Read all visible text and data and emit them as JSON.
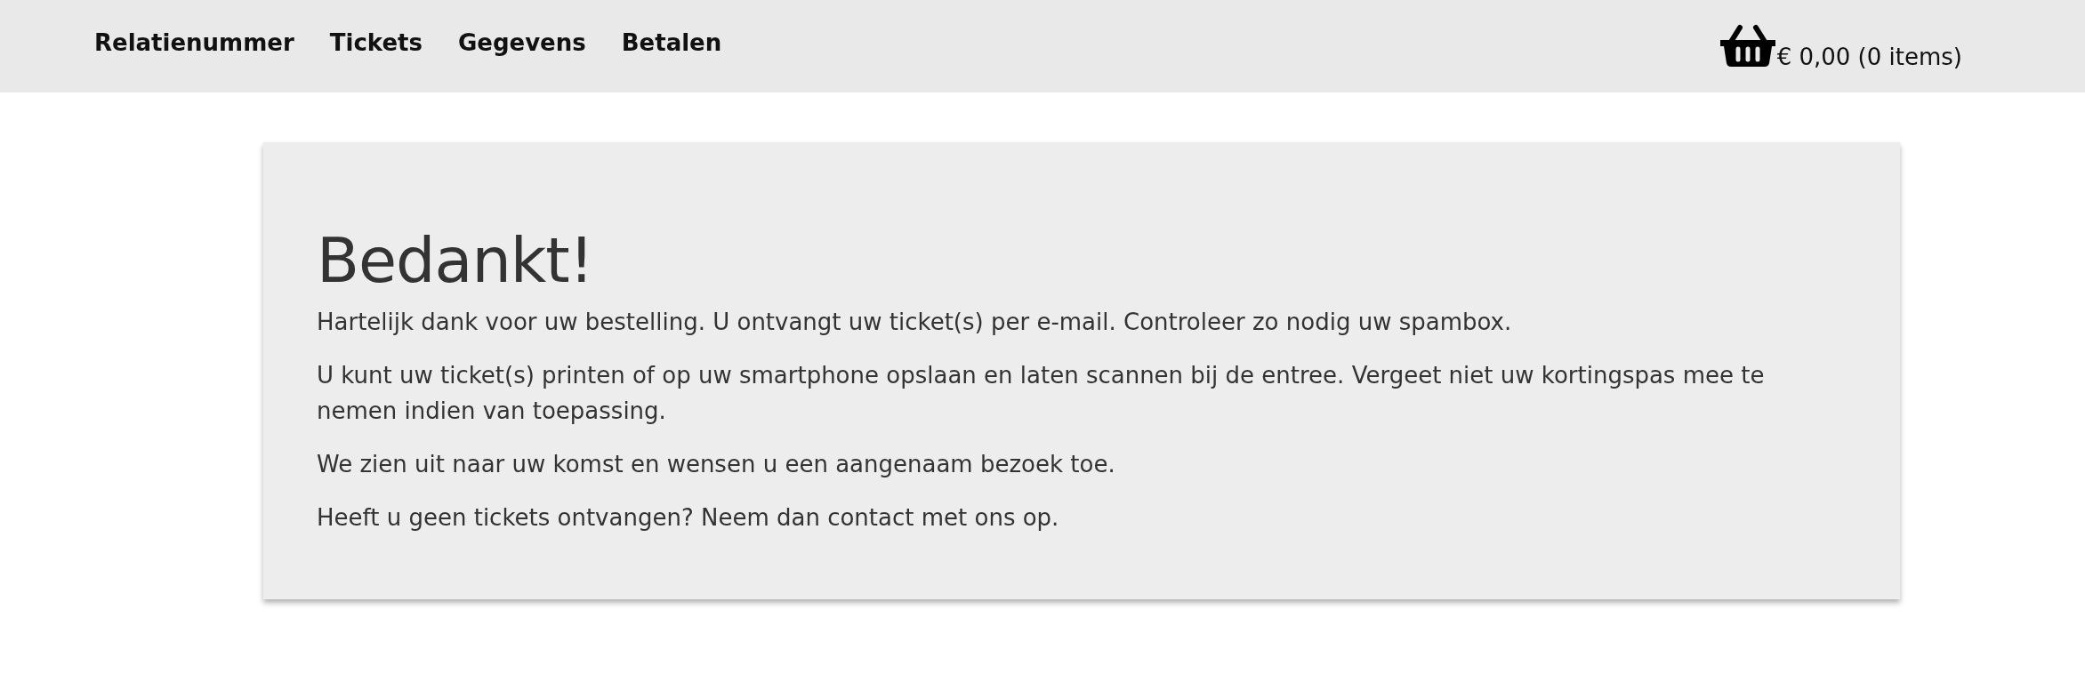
{
  "nav": {
    "items": [
      "Relatienummer",
      "Tickets",
      "Gegevens",
      "Betalen"
    ]
  },
  "cart": {
    "summary": "€ 0,00 (0 items)"
  },
  "card": {
    "title": "Bedankt!",
    "paragraphs": [
      "Hartelijk dank voor uw bestelling. U ontvangt uw ticket(s) per e-mail. Controleer zo nodig uw spambox.",
      "U kunt uw ticket(s) printen of op uw smartphone opslaan en laten scannen bij de entree. Vergeet niet uw kortingspas mee te nemen indien van toepassing.",
      "We zien uit naar uw komst en wensen u een aangenaam bezoek toe.",
      "Heeft u geen tickets ontvangen? Neem dan contact met ons op."
    ]
  }
}
